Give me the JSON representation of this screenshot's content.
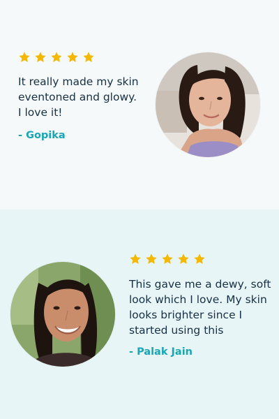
{
  "accent_color": "#17a7b8",
  "star_color": "#f5b800",
  "reviews": [
    {
      "rating": 5,
      "quote": "It really made my skin\neventoned and glowy.\nI love it!",
      "author": "- Gopika"
    },
    {
      "rating": 5,
      "quote": "This gave me a dewy, soft\nlook which I love. My skin\nlooks brighter since I\nstarted using this",
      "author": "- Palak Jain"
    }
  ]
}
